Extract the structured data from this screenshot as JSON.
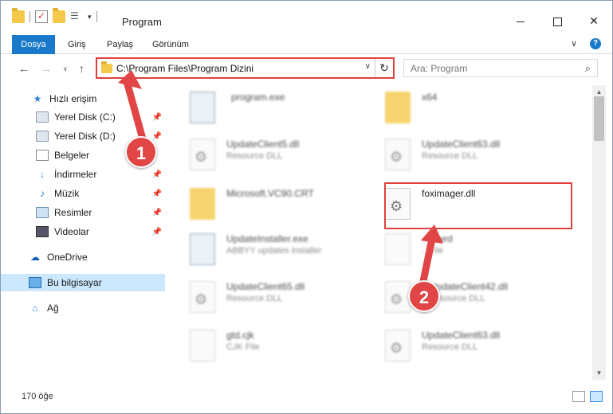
{
  "window": {
    "title": "Program",
    "controls": {
      "minimize": "",
      "maximize": "",
      "close": "✕"
    }
  },
  "qat": {
    "check_glyph": "✓",
    "props_glyph": "☰",
    "down_glyph": "▾"
  },
  "ribbon": {
    "tabs": [
      "Dosya",
      "Giriş",
      "Paylaş",
      "Görünüm"
    ],
    "expand_glyph": "∨",
    "help_glyph": "?"
  },
  "nav": {
    "back_glyph": "←",
    "forward_glyph": "→",
    "recent_glyph": "∨",
    "up_glyph": "↑",
    "address_path": "C:\\Program Files\\Program Dizini",
    "address_dropdown_glyph": "∨",
    "refresh_glyph": "↻",
    "search_placeholder": "Ara: Program",
    "search_glyph": "⌕"
  },
  "sidebar": {
    "pin_glyph": "📌",
    "items": [
      {
        "label": "Hızlı erişim",
        "icon": "star-icon",
        "glyph": "★",
        "pinned": false
      },
      {
        "label": "Yerel Disk (C:)",
        "icon": "disk-icon",
        "glyph": "",
        "pinned": true
      },
      {
        "label": "Yerel Disk (D:)",
        "icon": "disk-icon",
        "glyph": "",
        "pinned": true
      },
      {
        "label": "Belgeler",
        "icon": "documents-icon",
        "glyph": "",
        "pinned": false
      },
      {
        "label": "İndirmeler",
        "icon": "download-icon",
        "glyph": "↓",
        "pinned": true
      },
      {
        "label": "Müzik",
        "icon": "music-icon",
        "glyph": "♪",
        "pinned": true
      },
      {
        "label": "Resimler",
        "icon": "pictures-icon",
        "glyph": "",
        "pinned": true
      },
      {
        "label": "Videolar",
        "icon": "videos-icon",
        "glyph": "",
        "pinned": true
      },
      {
        "label": "OneDrive",
        "icon": "cloud-icon",
        "glyph": "☁",
        "pinned": false
      },
      {
        "label": "Bu bilgisayar",
        "icon": "computer-icon",
        "glyph": "",
        "pinned": false,
        "selected": true
      },
      {
        "label": "Ağ",
        "icon": "network-icon",
        "glyph": "⌂",
        "pinned": false
      }
    ]
  },
  "files": [
    {
      "name": "program.exe",
      "sub": "",
      "type": "exe",
      "blurred": true
    },
    {
      "name": "x64",
      "sub": "",
      "type": "folder",
      "blurred": true
    },
    {
      "name": "UpdateClient5.dll",
      "sub": "Resource DLL",
      "type": "dll",
      "blurred": true
    },
    {
      "name": "UpdateClient63.dll",
      "sub": "Resource DLL",
      "type": "dll",
      "blurred": true
    },
    {
      "name": "Microsoft.VC90.CRT",
      "sub": "",
      "type": "folder",
      "blurred": true
    },
    {
      "name": "foximager.dll",
      "sub": "",
      "type": "dll",
      "blurred": false
    },
    {
      "name": "UpdateInstaller.exe",
      "sub": "ABBYY updates installer",
      "type": "exe",
      "blurred": true
    },
    {
      "name": "...c.wrd",
      "sub": "...File",
      "type": "blank",
      "blurred": true
    },
    {
      "name": "UpdateClient65.dll",
      "sub": "Resource DLL",
      "type": "dll",
      "blurred": true
    },
    {
      "name": "...UpdateClient42.dll",
      "sub": "...Resource DLL",
      "type": "dll",
      "blurred": true
    },
    {
      "name": "gtd.cjk",
      "sub": "CJK File",
      "type": "blank",
      "blurred": true
    },
    {
      "name": "UpdateClient63.dll",
      "sub": "Resource DLL",
      "type": "dll",
      "blurred": true
    }
  ],
  "scrollbar": {
    "up_glyph": "▲",
    "down_glyph": "▼"
  },
  "status": {
    "count": "170 öğe"
  },
  "annotations": {
    "badge1": "1",
    "badge2": "2",
    "accent": "#e14545"
  }
}
